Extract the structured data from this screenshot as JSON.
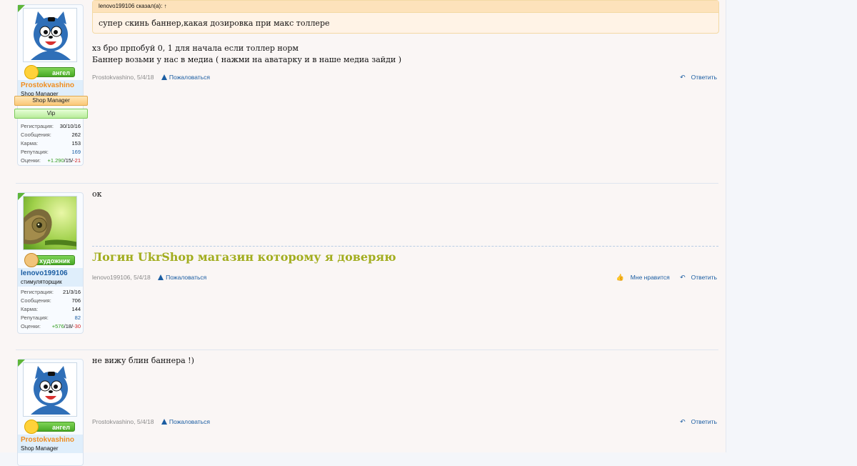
{
  "posts": [
    {
      "user": {
        "name": "Prostokvashino",
        "title": "Shop Manager",
        "rank": "ангел",
        "banners": [
          "Shop Manager",
          "Vip"
        ],
        "stats": {
          "registration": {
            "label": "Регистрация:",
            "value": "30/10/16"
          },
          "messages": {
            "label": "Сообщения:",
            "value": "262"
          },
          "karma": {
            "label": "Карма:",
            "value": "153"
          },
          "reputation": {
            "label": "Репутация:",
            "value": "169"
          },
          "ratings": {
            "label": "Оценки:",
            "pos": "+1.290",
            "neu": "15",
            "neg": "-21"
          }
        }
      },
      "quote": {
        "header": "lenovo199106 сказал(а): ↑",
        "body": "супер скинь баннер,какая дозировка при макс толлере"
      },
      "message_lines": [
        "хз бро прпобуй 0, 1 для начала если толлер норм",
        "Баннер возьми у нас в медиа ( нажми на аватарку и в наше медиа зайди )"
      ],
      "meta": {
        "author": "Prostokvashino",
        "date": "5/4/18",
        "report": "Пожаловаться",
        "reply": "Ответить"
      }
    },
    {
      "user": {
        "name": "lenovo199106",
        "title": "стимуляторщик",
        "rank": "художник",
        "stats": {
          "registration": {
            "label": "Регистрация:",
            "value": "21/3/16"
          },
          "messages": {
            "label": "Сообщения:",
            "value": "706"
          },
          "karma": {
            "label": "Карма:",
            "value": "144"
          },
          "reputation": {
            "label": "Репутация:",
            "value": "82"
          },
          "ratings": {
            "label": "Оценки:",
            "pos": "+576",
            "neu": "18",
            "neg": "-30"
          }
        }
      },
      "message_lines": [
        "ок"
      ],
      "signature": "Логин UkrShop магазин которому я доверяю",
      "meta": {
        "author": "lenovo199106",
        "date": "5/4/18",
        "report": "Пожаловаться",
        "like": "Мне нравится",
        "reply": "Ответить"
      }
    },
    {
      "user": {
        "name": "Prostokvashino",
        "title": "Shop Manager",
        "rank": "ангел"
      },
      "message_lines": [
        "не вижу блин баннера !)"
      ],
      "meta": {
        "author": "Prostokvashino",
        "date": "5/4/18",
        "report": "Пожаловаться",
        "reply": "Ответить"
      }
    }
  ],
  "colors": {
    "accent": "#1b5da2",
    "username_orange": "#f08d1e",
    "signature": "#a2ad1e",
    "rank_green": "#48a925"
  },
  "icons": [
    "warning-icon",
    "reply-icon",
    "like-icon",
    "cat-avatar",
    "chameleon-avatar",
    "angel-emoji-icon",
    "palette-icon"
  ]
}
